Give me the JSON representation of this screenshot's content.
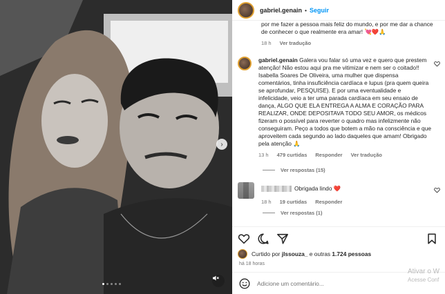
{
  "header": {
    "username": "gabriel.genain",
    "separator": "•",
    "follow_label": "Seguir"
  },
  "top_comment": {
    "text": "por me fazer a pessoa mais feliz do mundo, e por me dar a chance de conhecer o que realmente era amar! 💘❤️🙏",
    "time": "18 h",
    "translate": "Ver tradução"
  },
  "main_comment": {
    "username": "gabriel.genain",
    "text": "Galera vou falar só uma vez e quero que prestem atenção! Não estou aqui pra me vitimizar e nem ser o coitado!! Isabella Soares De Oliveira, uma mulher que dispensa comentários, tinha insuficiência cardíaca e lupus (pra quem queira se aprofundar, PESQUISE). E por uma eventualidade e infelicidade, veio a ter uma parada cardíaca em seu ensaio de dança, ALGO QUE ELA ENTREGA A ALMA E CORAÇÃO PARA REALIZAR, ONDE DEPOSITAVA TODO SEU AMOR, os médicos fizeram o possível para reverter o quadro mas infelizmente não conseguiram. Peço a todos que botem a mão na consciência e que aproveitem cada segundo ao lado daqueles que amam! Obrigado pela atenção 🙏",
    "time": "13 h",
    "likes": "479 curtidas",
    "reply": "Responder",
    "translate": "Ver tradução",
    "view_replies": "Ver respostas (15)"
  },
  "second_comment": {
    "text": "Obrigada lindo ❤️",
    "time": "18 h",
    "likes": "19 curtidas",
    "reply": "Responder",
    "view_replies": "Ver respostas (1)"
  },
  "likes": {
    "prefix": "Curtido por ",
    "user": "jlssouza_",
    "middle": " e outras ",
    "count": "1.724 pessoas"
  },
  "post_time": "há 18 horas",
  "add_comment": {
    "placeholder": "Adicione um comentário..."
  },
  "watermark": {
    "line1": "Ativar o W",
    "line2": "Acesse Conf"
  },
  "carousel": {
    "total_dots": 5,
    "active_dot": 1
  },
  "icons": [
    "heart-icon",
    "comment-icon",
    "share-icon",
    "bookmark-icon",
    "emoji-icon",
    "mute-icon",
    "chevron-right-icon"
  ],
  "colors": {
    "accent": "#0095f6",
    "heart": "#ed4956",
    "text": "#262626",
    "muted": "#737373"
  }
}
